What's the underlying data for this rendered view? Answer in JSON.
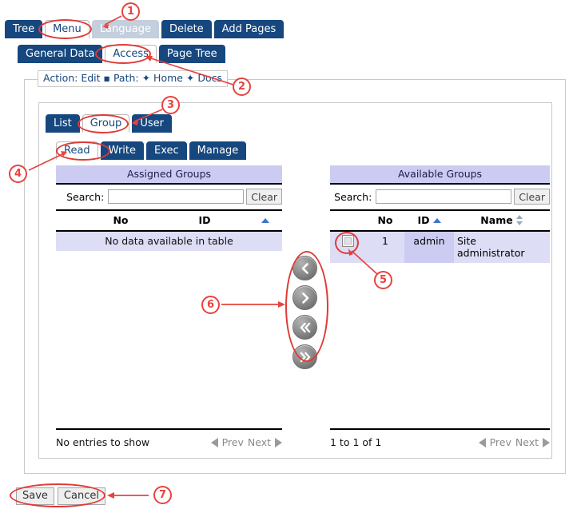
{
  "toolbar": {
    "row1": [
      {
        "label": "Tree",
        "state": "normal"
      },
      {
        "label": "Menu",
        "state": "selected"
      },
      {
        "label": "Language",
        "state": "dim"
      },
      {
        "label": "Delete",
        "state": "normal"
      },
      {
        "label": "Add Pages",
        "state": "normal"
      }
    ],
    "row2": [
      {
        "label": "General Data",
        "state": "normal"
      },
      {
        "label": "Access",
        "state": "selected"
      },
      {
        "label": "Page Tree",
        "state": "normal"
      }
    ]
  },
  "action_bar": {
    "action_label": "Action:",
    "action_value": "Edit",
    "separator": "▪",
    "path_label": "Path:",
    "diamond": "✦",
    "path_parts": [
      "Home",
      "Docs"
    ],
    "full_text": "Action: Edit ▪ Path: ✦ Home ✦ Docs"
  },
  "scope_tabs": [
    {
      "label": "List",
      "state": "normal"
    },
    {
      "label": "Group",
      "state": "selected"
    },
    {
      "label": "User",
      "state": "normal"
    }
  ],
  "permission_tabs": [
    {
      "label": "Read",
      "state": "selected"
    },
    {
      "label": "Write",
      "state": "normal"
    },
    {
      "label": "Exec",
      "state": "normal"
    },
    {
      "label": "Manage",
      "state": "normal"
    }
  ],
  "assigned": {
    "caption": "Assigned Groups",
    "search_label": "Search:",
    "search_value": "",
    "search_placeholder": "",
    "clear_label": "Clear",
    "columns": [
      {
        "label": "",
        "sort": "none"
      },
      {
        "label": "No",
        "sort": "none"
      },
      {
        "label": "ID",
        "sort": "none"
      },
      {
        "label": "",
        "sort": "asc"
      }
    ],
    "empty_message": "No data available in table",
    "rows": [],
    "footer_info": "No entries to show",
    "prev_label": "Prev",
    "next_label": "Next"
  },
  "available": {
    "caption": "Available Groups",
    "search_label": "Search:",
    "search_value": "",
    "search_placeholder": "",
    "clear_label": "Clear",
    "columns": [
      {
        "label": "",
        "sort": "none"
      },
      {
        "label": "No",
        "sort": "none"
      },
      {
        "label": "ID",
        "sort": "asc"
      },
      {
        "label": "Name",
        "sort": "both"
      }
    ],
    "rows": [
      {
        "checked": false,
        "no": "1",
        "id": "admin",
        "name": "Site administrator"
      }
    ],
    "footer_info": "1 to 1 of 1",
    "prev_label": "Prev",
    "next_label": "Next"
  },
  "transfer_buttons": [
    {
      "name": "move-left-icon",
      "glyph": "‹"
    },
    {
      "name": "move-right-icon",
      "glyph": "›"
    },
    {
      "name": "move-all-left-icon",
      "glyph": "«"
    },
    {
      "name": "move-all-right-icon",
      "glyph": "»"
    }
  ],
  "form_actions": {
    "save_label": "Save",
    "cancel_label": "Cancel"
  },
  "annotations": [
    {
      "number": "1",
      "target": "Language tab"
    },
    {
      "number": "2",
      "target": "Access tab"
    },
    {
      "number": "3",
      "target": "Group tab"
    },
    {
      "number": "4",
      "target": "Read tab"
    },
    {
      "number": "5",
      "target": "row selection checkbox"
    },
    {
      "number": "6",
      "target": "transfer arrow buttons"
    },
    {
      "number": "7",
      "target": "Save and Cancel buttons"
    }
  ],
  "colors": {
    "tab_blue": "#16477e",
    "caption_lavender": "#ccccf2",
    "row_lavender": "#ddddf5",
    "annotation_red": "#e8433f",
    "sort_arrow_blue": "#3e74c9"
  }
}
